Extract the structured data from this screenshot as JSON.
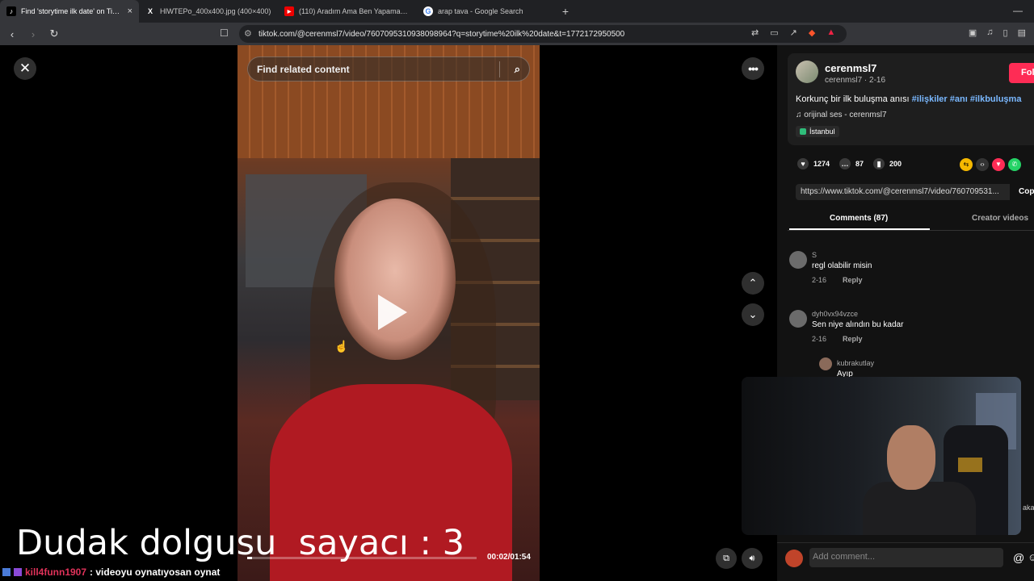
{
  "browser": {
    "tabs": [
      {
        "title": "Find 'storytime ilk date' on TikTo",
        "favicon": "tiktok-icon",
        "active": true
      },
      {
        "title": "HlWTEPo_400x400.jpg (400×400)",
        "favicon": "x-icon",
        "active": false
      },
      {
        "title": "(110) Aradım Ama Ben Yapamam - Y",
        "favicon": "youtube-icon",
        "active": false
      },
      {
        "title": "arap tava - Google Search",
        "favicon": "google-icon",
        "active": false
      }
    ],
    "url": "tiktok.com/@cerenmsl7/video/7607095310938098964?q=storytime%20ilk%20date&t=1772172950500"
  },
  "video": {
    "search_placeholder": "Find related content",
    "time": "00:02/01:54",
    "progress": 0.02
  },
  "overlay": {
    "counter_text": "Dudak dolgusu  sayacı : 3",
    "chat_user": "kill4funn1907",
    "chat_message": ": videoyu oynatıyosan oynat"
  },
  "post": {
    "username": "cerenmsl7",
    "subline": "cerenmsl7 · 2-16",
    "follow_label": "Fol",
    "description_text": "Korkunç bir ilk buluşma anısı ",
    "hashtags": [
      "#ilişkiler",
      "#anı",
      "#ilkbuluşma"
    ],
    "music": "orijinal ses - cerenmsl7",
    "location": "İstanbul",
    "likes": "1274",
    "comments": "87",
    "saves": "200",
    "link": "https://www.tiktok.com/@cerenmsl7/video/760709531...",
    "copy_label": "Copy"
  },
  "tabs": {
    "comments": "Comments (87)",
    "creator": "Creator videos"
  },
  "comments": [
    {
      "user": "S",
      "text": "regl olabilir misin",
      "date": "2-16",
      "reply": "Reply"
    },
    {
      "user": "dyh0vx94vzce",
      "text": "Sen niye alındın bu kadar",
      "date": "2-16",
      "reply": "Reply"
    }
  ],
  "reply": {
    "user": "kubrakutlay",
    "text": "Ayıp çünkü"
  },
  "add_comment_placeholder": "Add comment...",
  "webcam_side_text": "aka",
  "colors": {
    "accent": "#fe2c55",
    "hashtag": "#7ab8ff",
    "chat_user": "#e0325a"
  }
}
